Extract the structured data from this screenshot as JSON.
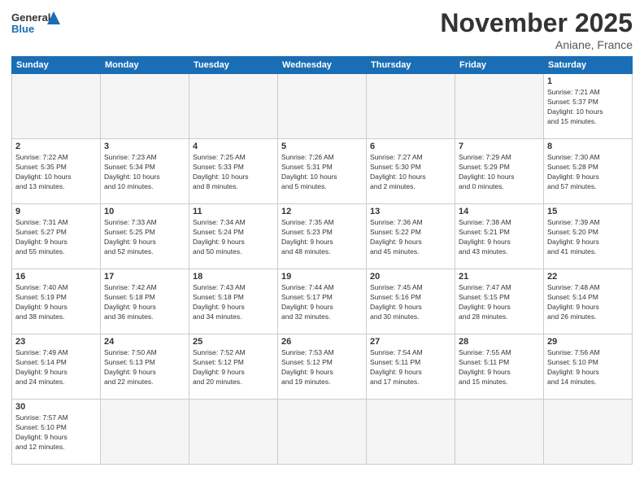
{
  "header": {
    "logo_general": "General",
    "logo_blue": "Blue",
    "month": "November 2025",
    "location": "Aniane, France"
  },
  "days_of_week": [
    "Sunday",
    "Monday",
    "Tuesday",
    "Wednesday",
    "Thursday",
    "Friday",
    "Saturday"
  ],
  "weeks": [
    [
      {
        "day": "",
        "info": ""
      },
      {
        "day": "",
        "info": ""
      },
      {
        "day": "",
        "info": ""
      },
      {
        "day": "",
        "info": ""
      },
      {
        "day": "",
        "info": ""
      },
      {
        "day": "",
        "info": ""
      },
      {
        "day": "1",
        "info": "Sunrise: 7:21 AM\nSunset: 5:37 PM\nDaylight: 10 hours\nand 15 minutes."
      }
    ],
    [
      {
        "day": "2",
        "info": "Sunrise: 7:22 AM\nSunset: 5:35 PM\nDaylight: 10 hours\nand 13 minutes."
      },
      {
        "day": "3",
        "info": "Sunrise: 7:23 AM\nSunset: 5:34 PM\nDaylight: 10 hours\nand 10 minutes."
      },
      {
        "day": "4",
        "info": "Sunrise: 7:25 AM\nSunset: 5:33 PM\nDaylight: 10 hours\nand 8 minutes."
      },
      {
        "day": "5",
        "info": "Sunrise: 7:26 AM\nSunset: 5:31 PM\nDaylight: 10 hours\nand 5 minutes."
      },
      {
        "day": "6",
        "info": "Sunrise: 7:27 AM\nSunset: 5:30 PM\nDaylight: 10 hours\nand 2 minutes."
      },
      {
        "day": "7",
        "info": "Sunrise: 7:29 AM\nSunset: 5:29 PM\nDaylight: 10 hours\nand 0 minutes."
      },
      {
        "day": "8",
        "info": "Sunrise: 7:30 AM\nSunset: 5:28 PM\nDaylight: 9 hours\nand 57 minutes."
      }
    ],
    [
      {
        "day": "9",
        "info": "Sunrise: 7:31 AM\nSunset: 5:27 PM\nDaylight: 9 hours\nand 55 minutes."
      },
      {
        "day": "10",
        "info": "Sunrise: 7:33 AM\nSunset: 5:25 PM\nDaylight: 9 hours\nand 52 minutes."
      },
      {
        "day": "11",
        "info": "Sunrise: 7:34 AM\nSunset: 5:24 PM\nDaylight: 9 hours\nand 50 minutes."
      },
      {
        "day": "12",
        "info": "Sunrise: 7:35 AM\nSunset: 5:23 PM\nDaylight: 9 hours\nand 48 minutes."
      },
      {
        "day": "13",
        "info": "Sunrise: 7:36 AM\nSunset: 5:22 PM\nDaylight: 9 hours\nand 45 minutes."
      },
      {
        "day": "14",
        "info": "Sunrise: 7:38 AM\nSunset: 5:21 PM\nDaylight: 9 hours\nand 43 minutes."
      },
      {
        "day": "15",
        "info": "Sunrise: 7:39 AM\nSunset: 5:20 PM\nDaylight: 9 hours\nand 41 minutes."
      }
    ],
    [
      {
        "day": "16",
        "info": "Sunrise: 7:40 AM\nSunset: 5:19 PM\nDaylight: 9 hours\nand 38 minutes."
      },
      {
        "day": "17",
        "info": "Sunrise: 7:42 AM\nSunset: 5:18 PM\nDaylight: 9 hours\nand 36 minutes."
      },
      {
        "day": "18",
        "info": "Sunrise: 7:43 AM\nSunset: 5:18 PM\nDaylight: 9 hours\nand 34 minutes."
      },
      {
        "day": "19",
        "info": "Sunrise: 7:44 AM\nSunset: 5:17 PM\nDaylight: 9 hours\nand 32 minutes."
      },
      {
        "day": "20",
        "info": "Sunrise: 7:45 AM\nSunset: 5:16 PM\nDaylight: 9 hours\nand 30 minutes."
      },
      {
        "day": "21",
        "info": "Sunrise: 7:47 AM\nSunset: 5:15 PM\nDaylight: 9 hours\nand 28 minutes."
      },
      {
        "day": "22",
        "info": "Sunrise: 7:48 AM\nSunset: 5:14 PM\nDaylight: 9 hours\nand 26 minutes."
      }
    ],
    [
      {
        "day": "23",
        "info": "Sunrise: 7:49 AM\nSunset: 5:14 PM\nDaylight: 9 hours\nand 24 minutes."
      },
      {
        "day": "24",
        "info": "Sunrise: 7:50 AM\nSunset: 5:13 PM\nDaylight: 9 hours\nand 22 minutes."
      },
      {
        "day": "25",
        "info": "Sunrise: 7:52 AM\nSunset: 5:12 PM\nDaylight: 9 hours\nand 20 minutes."
      },
      {
        "day": "26",
        "info": "Sunrise: 7:53 AM\nSunset: 5:12 PM\nDaylight: 9 hours\nand 19 minutes."
      },
      {
        "day": "27",
        "info": "Sunrise: 7:54 AM\nSunset: 5:11 PM\nDaylight: 9 hours\nand 17 minutes."
      },
      {
        "day": "28",
        "info": "Sunrise: 7:55 AM\nSunset: 5:11 PM\nDaylight: 9 hours\nand 15 minutes."
      },
      {
        "day": "29",
        "info": "Sunrise: 7:56 AM\nSunset: 5:10 PM\nDaylight: 9 hours\nand 14 minutes."
      }
    ],
    [
      {
        "day": "30",
        "info": "Sunrise: 7:57 AM\nSunset: 5:10 PM\nDaylight: 9 hours\nand 12 minutes."
      },
      {
        "day": "",
        "info": ""
      },
      {
        "day": "",
        "info": ""
      },
      {
        "day": "",
        "info": ""
      },
      {
        "day": "",
        "info": ""
      },
      {
        "day": "",
        "info": ""
      },
      {
        "day": "",
        "info": ""
      }
    ]
  ]
}
